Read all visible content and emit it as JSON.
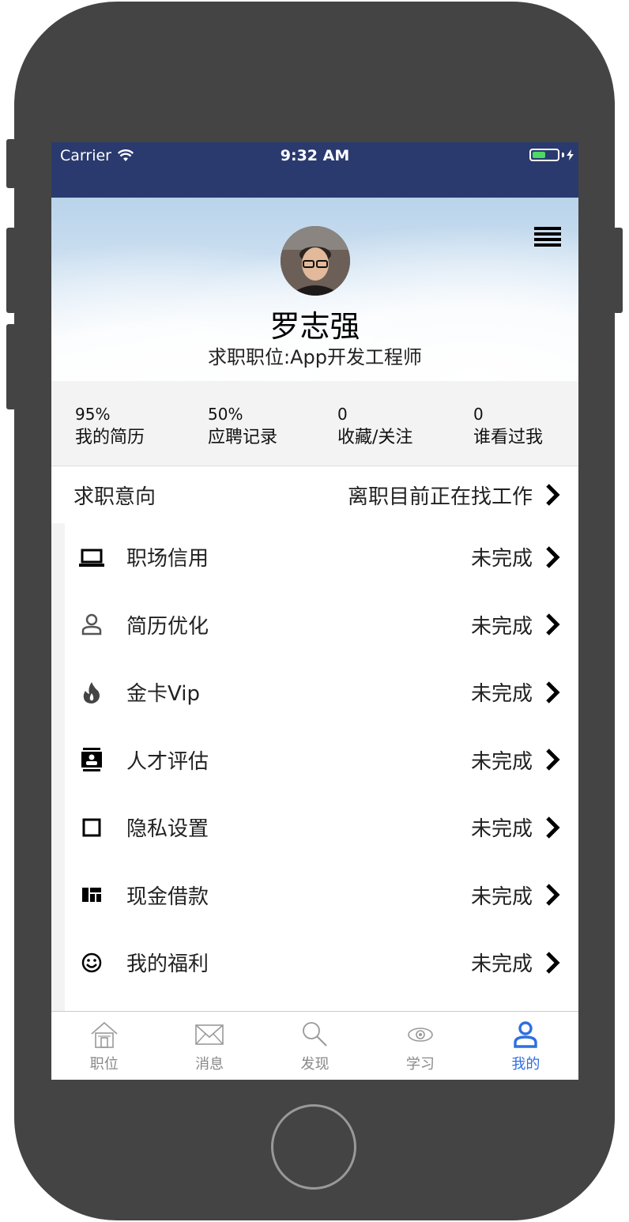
{
  "status_bar": {
    "carrier": "Carrier",
    "time": "9:32 AM"
  },
  "profile": {
    "name": "罗志强",
    "subtitle": "求职职位:App开发工程师",
    "avatar_icon": "user-avatar-photo",
    "menu_icon": "hamburger-menu-icon"
  },
  "stats": [
    {
      "value": "95%",
      "label": "我的简历"
    },
    {
      "value": "50%",
      "label": "应聘记录"
    },
    {
      "value": "0",
      "label": "收藏/关注"
    },
    {
      "value": "0",
      "label": "谁看过我"
    }
  ],
  "intent": {
    "label": "求职意向",
    "value": "离职目前正在找工作"
  },
  "menu_items": [
    {
      "label": "职场信用",
      "status": "未完成",
      "icon": "laptop-icon"
    },
    {
      "label": "简历优化",
      "status": "未完成",
      "icon": "person-icon"
    },
    {
      "label": "金卡Vip",
      "status": "未完成",
      "icon": "fire-icon"
    },
    {
      "label": "人才评估",
      "status": "未完成",
      "icon": "contact-card-icon"
    },
    {
      "label": "隐私设置",
      "status": "未完成",
      "icon": "square-icon"
    },
    {
      "label": "现金借款",
      "status": "未完成",
      "icon": "dashboard-icon"
    },
    {
      "label": "我的福利",
      "status": "未完成",
      "icon": "smile-icon"
    }
  ],
  "tabs": [
    {
      "label": "职位",
      "icon": "house-icon",
      "active": false
    },
    {
      "label": "消息",
      "icon": "envelope-icon",
      "active": false
    },
    {
      "label": "发现",
      "icon": "search-icon",
      "active": false
    },
    {
      "label": "学习",
      "icon": "eye-icon",
      "active": false
    },
    {
      "label": "我的",
      "icon": "person-icon",
      "active": true
    }
  ],
  "colors": {
    "status_bar": "#2a3a6e",
    "accent": "#2f6fde",
    "phone_frame": "#444444"
  }
}
